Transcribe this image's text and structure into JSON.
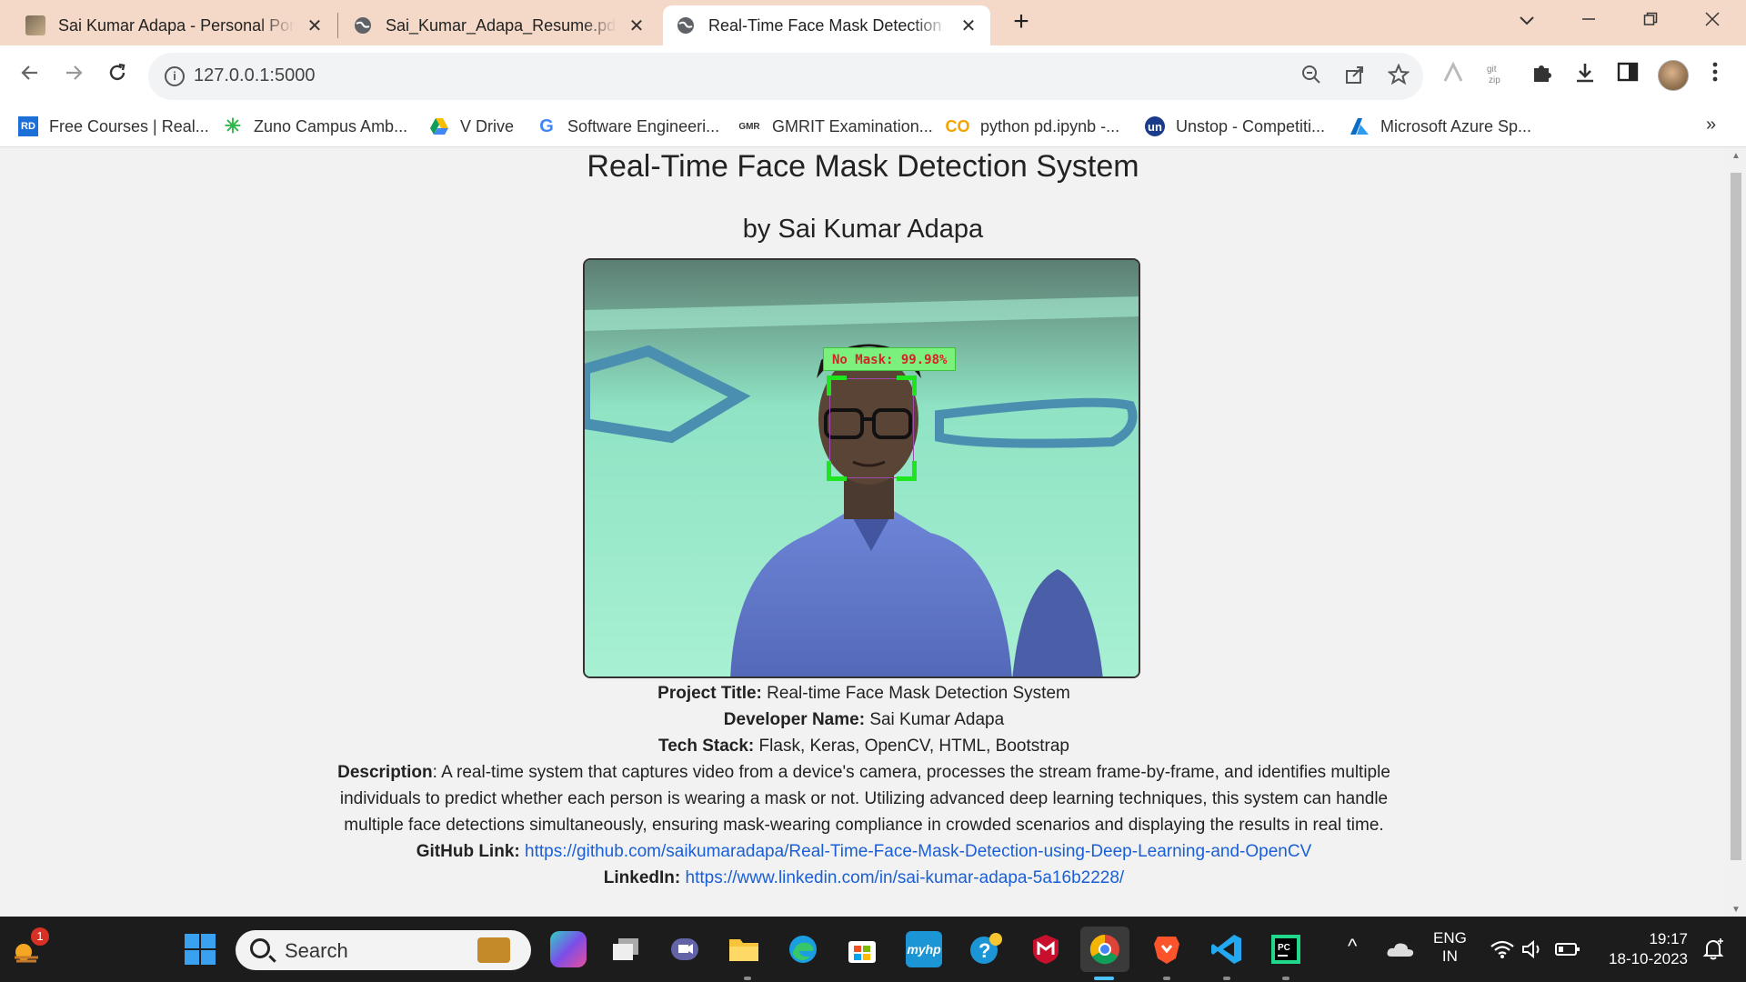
{
  "browser": {
    "tabs": [
      {
        "title": "Sai Kumar Adapa - Personal Port",
        "icon": "portrait-favicon"
      },
      {
        "title": "Sai_Kumar_Adapa_Resume.pdf",
        "icon": "globe-icon"
      },
      {
        "title": "Real-Time Face Mask Detection S",
        "icon": "globe-icon",
        "active": true
      }
    ],
    "tab_close": "✕",
    "new_tab": "+",
    "url": "127.0.0.1:5000",
    "bookmarks": [
      {
        "label": "Free Courses | Real...",
        "icon": "RD"
      },
      {
        "label": "Zuno Campus Amb...",
        "icon": "✳"
      },
      {
        "label": "V Drive",
        "icon": "drive-icon"
      },
      {
        "label": "Software Engineeri...",
        "icon": "G"
      },
      {
        "label": "GMRIT Examination...",
        "icon": "GMR"
      },
      {
        "label": "python pd.ipynb -...",
        "icon": "CO"
      },
      {
        "label": "Unstop - Competiti...",
        "icon": "un"
      },
      {
        "label": "Microsoft Azure Sp...",
        "icon": "azure-icon"
      }
    ],
    "bookmarks_more": "»"
  },
  "page": {
    "title": "Real-Time Face Mask Detection System",
    "subtitle": "by Sai Kumar Adapa",
    "detection_label": "No Mask: 99.98%",
    "info": {
      "project_title_label": "Project Title:",
      "project_title": "Real-time Face Mask Detection System",
      "developer_label": "Developer Name:",
      "developer": "Sai Kumar Adapa",
      "tech_label": "Tech Stack:",
      "tech": "Flask, Keras, OpenCV, HTML, Bootstrap",
      "description_label": "Description",
      "description_line1": ": A real-time system that captures video from a device's camera, processes the stream frame-by-frame, and identifies multiple",
      "description_line2": "individuals to predict whether each person is wearing a mask or not. Utilizing advanced deep learning techniques, this system can handle",
      "description_line3": "multiple face detections simultaneously, ensuring mask-wearing compliance in crowded scenarios and displaying the results in real time.",
      "github_label": "GitHub Link:",
      "github_url": "https://github.com/saikumaradapa/Real-Time-Face-Mask-Detection-using-Deep-Learning-and-OpenCV",
      "linkedin_label": "LinkedIn:",
      "linkedin_url": "https://www.linkedin.com/in/sai-kumar-adapa-5a16b2228/"
    }
  },
  "taskbar": {
    "search_placeholder": "Search",
    "notification_count": "1",
    "language_line1": "ENG",
    "language_line2": "IN",
    "time": "19:17",
    "date": "18-10-2023",
    "chevron": "^"
  }
}
